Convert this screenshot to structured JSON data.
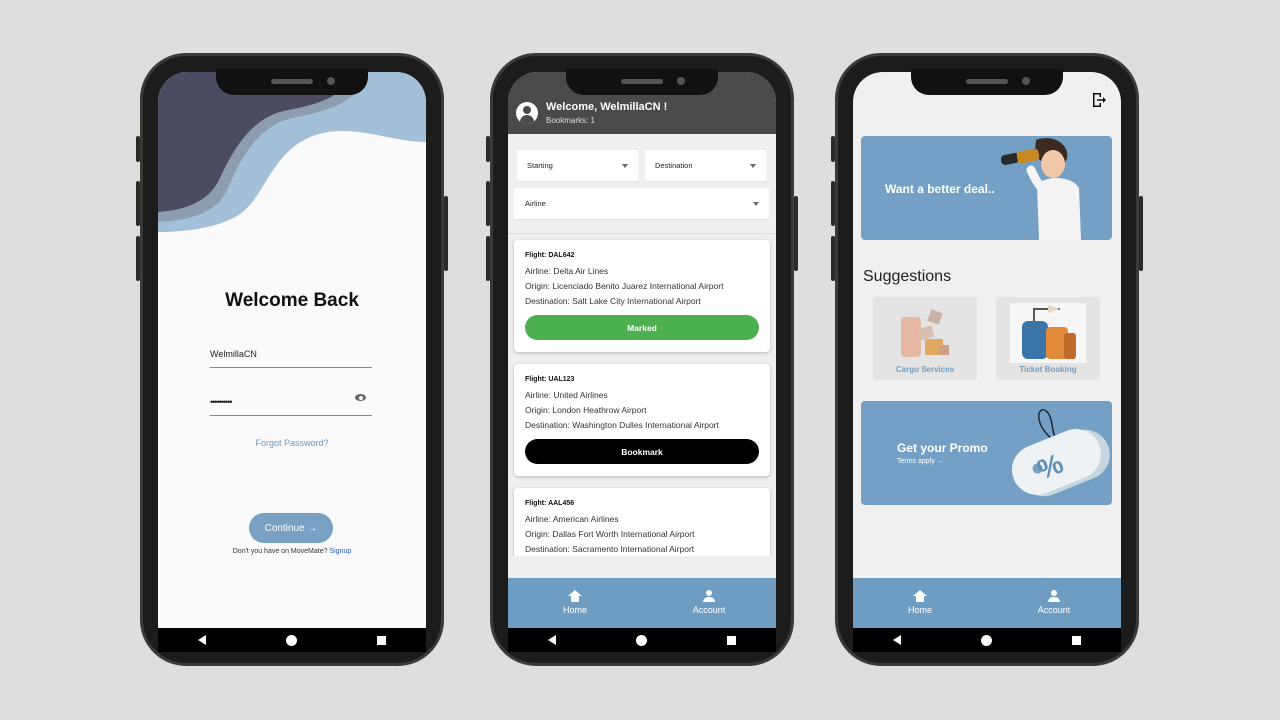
{
  "login": {
    "title": "Welcome Back",
    "username_value": "WelmillaCN",
    "password_mask": "••••••••••",
    "forgot_label": "Forgot Password?",
    "continue_label": "Continue →",
    "signup_prompt": "Don't you have on MoveMate?",
    "signup_link": "Signup"
  },
  "flights": {
    "welcome": "Welcome, WelmillaCN !",
    "bookmarks": "Bookmarks: 1",
    "filters": {
      "starting": "Starting",
      "destination": "Destination",
      "airline": "Airline"
    },
    "cards": [
      {
        "flight": "Flight: DAL642",
        "airline": "Airline: Delta Air Lines",
        "origin": "Origin: Licenciado Benito Juarez International Airport",
        "destination": "Destination: Salt Lake City International Airport",
        "action": "Marked"
      },
      {
        "flight": "Flight: UAL123",
        "airline": "Airline: United Airlines",
        "origin": "Origin: London Heathrow Airport",
        "destination": "Destination: Washington Dulles International Airport",
        "action": "Bookmark"
      },
      {
        "flight": "Flight: AAL456",
        "airline": "Airline: American Airlines",
        "origin": "Origin: Dallas Fort Worth International Airport",
        "destination": "Destination: Sacramento International Airport"
      }
    ]
  },
  "tabs": {
    "home": "Home",
    "account": "Account"
  },
  "home": {
    "deal_banner": "Want a better deal..",
    "suggestions_title": "Suggestions",
    "suggestions": [
      {
        "label": "Cargo Services"
      },
      {
        "label": "Ticket Booking"
      }
    ],
    "promo_title": "Get your Promo",
    "promo_sub": "Terms apply →",
    "promo_symbol": "%"
  },
  "colors": {
    "accent": "#6f9dc2",
    "header": "#4a4a4a",
    "marked": "#4caf50"
  }
}
